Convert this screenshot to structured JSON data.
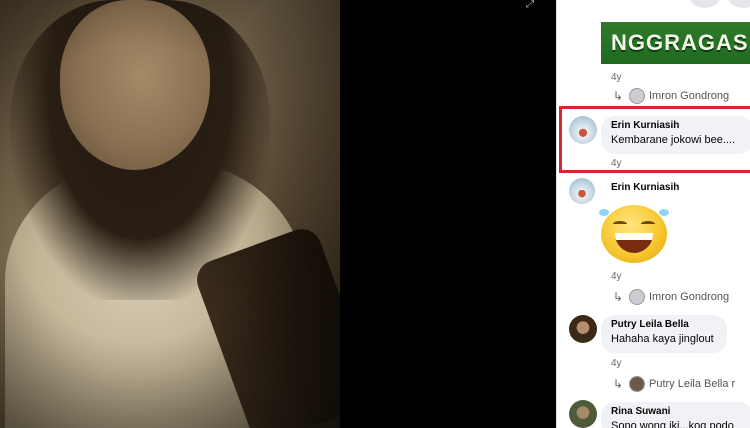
{
  "viewer": {
    "expand_icon": "expand-icon"
  },
  "banner": {
    "text": "NGGRAGAS"
  },
  "comments": [
    {
      "time": "4y",
      "reply_author": "Imron Gondrong"
    },
    {
      "author": "Erin Kurniasih",
      "text": "Kembarane jokowi bee....",
      "time": "4y"
    },
    {
      "author": "Erin Kurniasih",
      "sticker": "laughing-emoji",
      "time": "4y",
      "reply_author": "Imron Gondrong"
    },
    {
      "author": "Putry Leila Bella",
      "text": "Hahaha kaya jinglout",
      "time": "4y",
      "reply_author": "Putry Leila Bella r"
    },
    {
      "author": "Rina Suwani",
      "text": "Sopo wong iki...koq podo"
    }
  ],
  "colors": {
    "highlight": "#d7262e",
    "bubble": "#f0f2f5",
    "meta": "#65676b"
  }
}
